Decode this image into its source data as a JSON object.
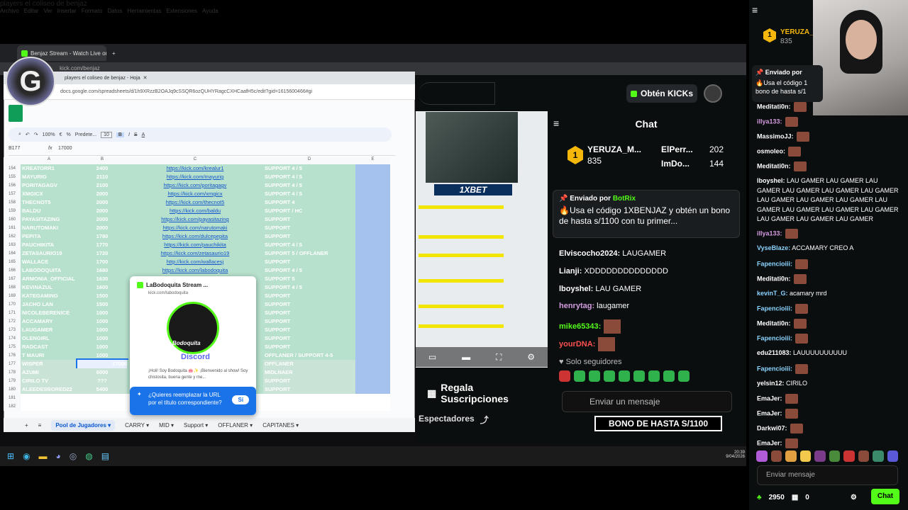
{
  "browser": {
    "tab_title": "Benjaz Stream - Watch Live on Kick",
    "address": "kick.com/benjaz"
  },
  "sheets": {
    "tab_title": "players el coliseo de benjaz - Hoja",
    "url": "docs.google.com/spreadsheets/d/1h9XRzzB2OAJq9cSSQR6ozQUHYRagcCXHCaafH5c/edit?gid=1615600466#gi",
    "title": "players el coliseo de benjaz",
    "menu": [
      "Archivo",
      "Editar",
      "Ver",
      "Insertar",
      "Formato",
      "Datos",
      "Herramientas",
      "Extensiones",
      "Ayuda"
    ],
    "zoom": "100%",
    "font": "Predete...",
    "font_size": "10",
    "cell_ref": "B177",
    "formula": "17000",
    "columns": [
      "A",
      "B",
      "C",
      "D",
      "E"
    ],
    "rows": [
      {
        "n": "154",
        "a": "KREATORR1",
        "b": "2400",
        "c": "https://kick.com/krealur1",
        "d": "SUPPORT 4 / 5"
      },
      {
        "n": "155",
        "a": "MAYURIG",
        "b": "2110",
        "c": "https://kick.com/mayurig",
        "d": "SUPPORT 4 / 5"
      },
      {
        "n": "156",
        "a": "PORITAGAGV",
        "b": "2100",
        "c": "https://kick.com/poritagagv",
        "d": "SUPPORT 4 / 5"
      },
      {
        "n": "157",
        "a": "XMGICX",
        "b": "2000",
        "c": "https://kick.com/xmgicx",
        "d": "SUPPORT 4 / 5"
      },
      {
        "n": "158",
        "a": "THECNOT5",
        "b": "2000",
        "c": "https://kick.com/thecnot5",
        "d": "SUPPORT 4"
      },
      {
        "n": "159",
        "a": "BALDU",
        "b": "2000",
        "c": "https://kick.com/baldu",
        "d": "SUPPORT / HC"
      },
      {
        "n": "160",
        "a": "PAYASITAZING",
        "b": "2000",
        "c": "https://kick.com/payasitazing",
        "d": "SUPPORT"
      },
      {
        "n": "161",
        "a": "NARUTOMAKI",
        "b": "2000",
        "c": "https://kick.com/narutomaki",
        "d": "SUPPORT"
      },
      {
        "n": "162",
        "a": "PEPITA",
        "b": "1780",
        "c": "https://kick.com/dulcepepita",
        "d": "SUPPORT"
      },
      {
        "n": "163",
        "a": "PAUCHIKITA",
        "b": "1770",
        "c": "https://kick.com/pauchikita",
        "d": "SUPPORT 4 / 5"
      },
      {
        "n": "164",
        "a": "ZETASAURIO19",
        "b": "1720",
        "c": "https://kick.com/zetasaurio19",
        "d": "SUPPORT 5 / OFFLANER"
      },
      {
        "n": "165",
        "a": "WALLACE",
        "b": "1700",
        "c": "http://kick.com/wallacesj",
        "d": "SUPPORT"
      },
      {
        "n": "166",
        "a": "LABODOQUITA",
        "b": "1680",
        "c": "https://kick.com/labodoquita",
        "d": "SUPPORT 4 / 5"
      },
      {
        "n": "167",
        "a": "ARMONIA_OFFICIAL",
        "b": "1630",
        "c": "",
        "d": "SUPPORT 5"
      },
      {
        "n": "168",
        "a": "KEVINAZUL",
        "b": "1600",
        "c": "",
        "d": "SUPPORT 4 / 5"
      },
      {
        "n": "169",
        "a": "KATEGAMING",
        "b": "1500",
        "c": "",
        "d": "SUPPORT"
      },
      {
        "n": "170",
        "a": "JACHO LAN",
        "b": "1500",
        "c": "",
        "d": "SUPPORT"
      },
      {
        "n": "171",
        "a": "NICOLEBERENICE",
        "b": "1000",
        "c": "",
        "d": "SUPPORT"
      },
      {
        "n": "172",
        "a": "ACCAMARY",
        "b": "1000",
        "c": "",
        "d": "SUPPORT"
      },
      {
        "n": "173",
        "a": "LAUGAMER",
        "b": "1000",
        "c": "",
        "d": "SUPPORT"
      },
      {
        "n": "174",
        "a": "OLENGIRL",
        "b": "1000",
        "c": "",
        "d": "SUPPORT"
      },
      {
        "n": "175",
        "a": "RADCAST",
        "b": "1000",
        "c": "",
        "d": "SUPPORT"
      },
      {
        "n": "176",
        "a": "T MAURI",
        "b": "1000",
        "c": "",
        "d": "OFFLANER / SUPPORT 4-5"
      },
      {
        "n": "177",
        "a": "WISPER",
        "b": "17000",
        "c": "",
        "d": "OFFLANER"
      },
      {
        "n": "178",
        "a": "AZUMI",
        "b": "6000",
        "c": "",
        "d": "MIDLNAER"
      },
      {
        "n": "179",
        "a": "CIRILO TV",
        "b": "???",
        "c": "",
        "d": "SUPPORT"
      },
      {
        "n": "180",
        "a": "ALEEDESBORED22",
        "b": "5400",
        "c": "",
        "d": "SUPPORT"
      },
      {
        "n": "181",
        "a": "",
        "b": "",
        "c": "",
        "d": ""
      },
      {
        "n": "182",
        "a": "",
        "b": "",
        "c": "",
        "d": ""
      }
    ],
    "sheet_tabs": [
      "Pool de Jugadores",
      "CARRY",
      "MID",
      "Support",
      "OFFLANER",
      "CAPITANES"
    ],
    "preview": {
      "title": "LaBodoquita Stream ...",
      "url": "kick.com/labodoquita",
      "brand": "Bodoquita",
      "discord": "Discord",
      "desc": "¡Holi! Soy Bodoquita 🐽✨ ¡Bienvenido al show! Soy chistosita, buena gente y me...",
      "replace": "¿Quieres reemplazar la URL por el título correspondiente?",
      "yes": "Sí"
    }
  },
  "kick": {
    "get_kicks": "Obtén KICKs",
    "bet": "1XBET",
    "gift": "Regala Suscripciones",
    "viewers": "Espectadores",
    "chat_title": "Chat",
    "leader": [
      {
        "name": "YERUZA_M...",
        "value": "835"
      },
      {
        "name": "ElPerr...",
        "value": "202"
      },
      {
        "name": "ImDo...",
        "value": "144"
      }
    ],
    "pinned_by": "Enviado por",
    "pinned_user": "BotRix",
    "pinned_msg": "🔥Usa el código 1XBENJAZ y obtén un bono de hasta s/1100 con tu primer...",
    "messages": [
      {
        "user": "Elviscocho2024:",
        "text": "LAUGAMER",
        "color": "#ffffff"
      },
      {
        "user": "Lianji:",
        "text": "XDDDDDDDDDDDDDD",
        "color": "#ffffff"
      },
      {
        "user": "lboyshel:",
        "text": "LAU GAMER",
        "color": "#ffffff"
      },
      {
        "user": "henrytag:",
        "text": "laugamer",
        "color": "#d39be0"
      },
      {
        "user": "mike65343:",
        "text": "",
        "color": "#53fc18"
      },
      {
        "user": "yourDNA:",
        "text": "",
        "color": "#ff5050"
      }
    ],
    "followers_only": "Solo seguidores",
    "input_placeholder": "Enviar un mensaje",
    "bono": "BONO DE HASTA S/1100"
  },
  "outer_chat": {
    "top_user": "YERUZA_M",
    "top_value": "835",
    "pinned_by": "Enviado por",
    "pinned_msg": "🔥Usa el código 1 bono de hasta s/1",
    "messages": [
      {
        "user": "Meditati0n:",
        "text": "",
        "color": "#ffffff",
        "emote": true
      },
      {
        "user": "illya133:",
        "text": "",
        "color": "#d39be0",
        "emote": true
      },
      {
        "user": "MassimoJJ:",
        "text": "",
        "color": "#ffffff",
        "emote": true
      },
      {
        "user": "osmoleo:",
        "text": "",
        "color": "#ffffff",
        "emote": true
      },
      {
        "user": "Meditati0n:",
        "text": "",
        "color": "#ffffff",
        "emote": true
      },
      {
        "user": "lboyshel:",
        "text": "LAU GAMER LAU GAMER LAU GAMER LAU GAMER LAU GAMER LAU GAMER LAU GAMER LAU GAMER LAU GAMER LAU GAMER LAU GAMER LAU GAMER LAU GAMER LAU GAMER LAU GAMER LAU GAMER",
        "color": "#ffffff",
        "emote": false
      },
      {
        "user": "illya133:",
        "text": "",
        "color": "#d39be0",
        "emote": true
      },
      {
        "user": "VyseBlaze:",
        "text": "ACCAMARY CREO A",
        "color": "#8ad4ff",
        "emote": false
      },
      {
        "user": "Fapencioiii:",
        "text": "",
        "color": "#8ad4ff",
        "emote": true
      },
      {
        "user": "Meditati0n:",
        "text": "",
        "color": "#ffffff",
        "emote": true
      },
      {
        "user": "kevinT_G:",
        "text": "acamary mrd",
        "color": "#8ad4ff",
        "emote": false
      },
      {
        "user": "Fapencioiii:",
        "text": "",
        "color": "#8ad4ff",
        "emote": true
      },
      {
        "user": "Meditati0n:",
        "text": "",
        "color": "#ffffff",
        "emote": true
      },
      {
        "user": "Fapencioiii:",
        "text": "",
        "color": "#8ad4ff",
        "emote": true
      },
      {
        "user": "edu211083:",
        "text": "LAUUUUUUUUUU",
        "color": "#ffffff",
        "emote": false
      },
      {
        "user": "Fapencioiii:",
        "text": "",
        "color": "#8ad4ff",
        "emote": true
      },
      {
        "user": "yelsin12:",
        "text": "CIRILO",
        "color": "#ffffff",
        "emote": false
      },
      {
        "user": "EmaJer:",
        "text": "",
        "color": "#ffffff",
        "emote": true
      },
      {
        "user": "EmaJer:",
        "text": "",
        "color": "#ffffff",
        "emote": true
      },
      {
        "user": "Darkwi07:",
        "text": "",
        "color": "#ffffff",
        "emote": true
      },
      {
        "user": "EmaJer:",
        "text": "",
        "color": "#ffffff",
        "emote": true
      }
    ],
    "input_placeholder": "Enviar mensaje",
    "points": "2950",
    "gifts": "0",
    "chat_button": "Chat"
  },
  "taskbar": {
    "time": "20:39",
    "date": "9/04/2026"
  },
  "colors": {
    "kick_green": "#53fc18",
    "sheet_green": "#b7e1cd",
    "sheet_blue": "#a5c2ee"
  }
}
